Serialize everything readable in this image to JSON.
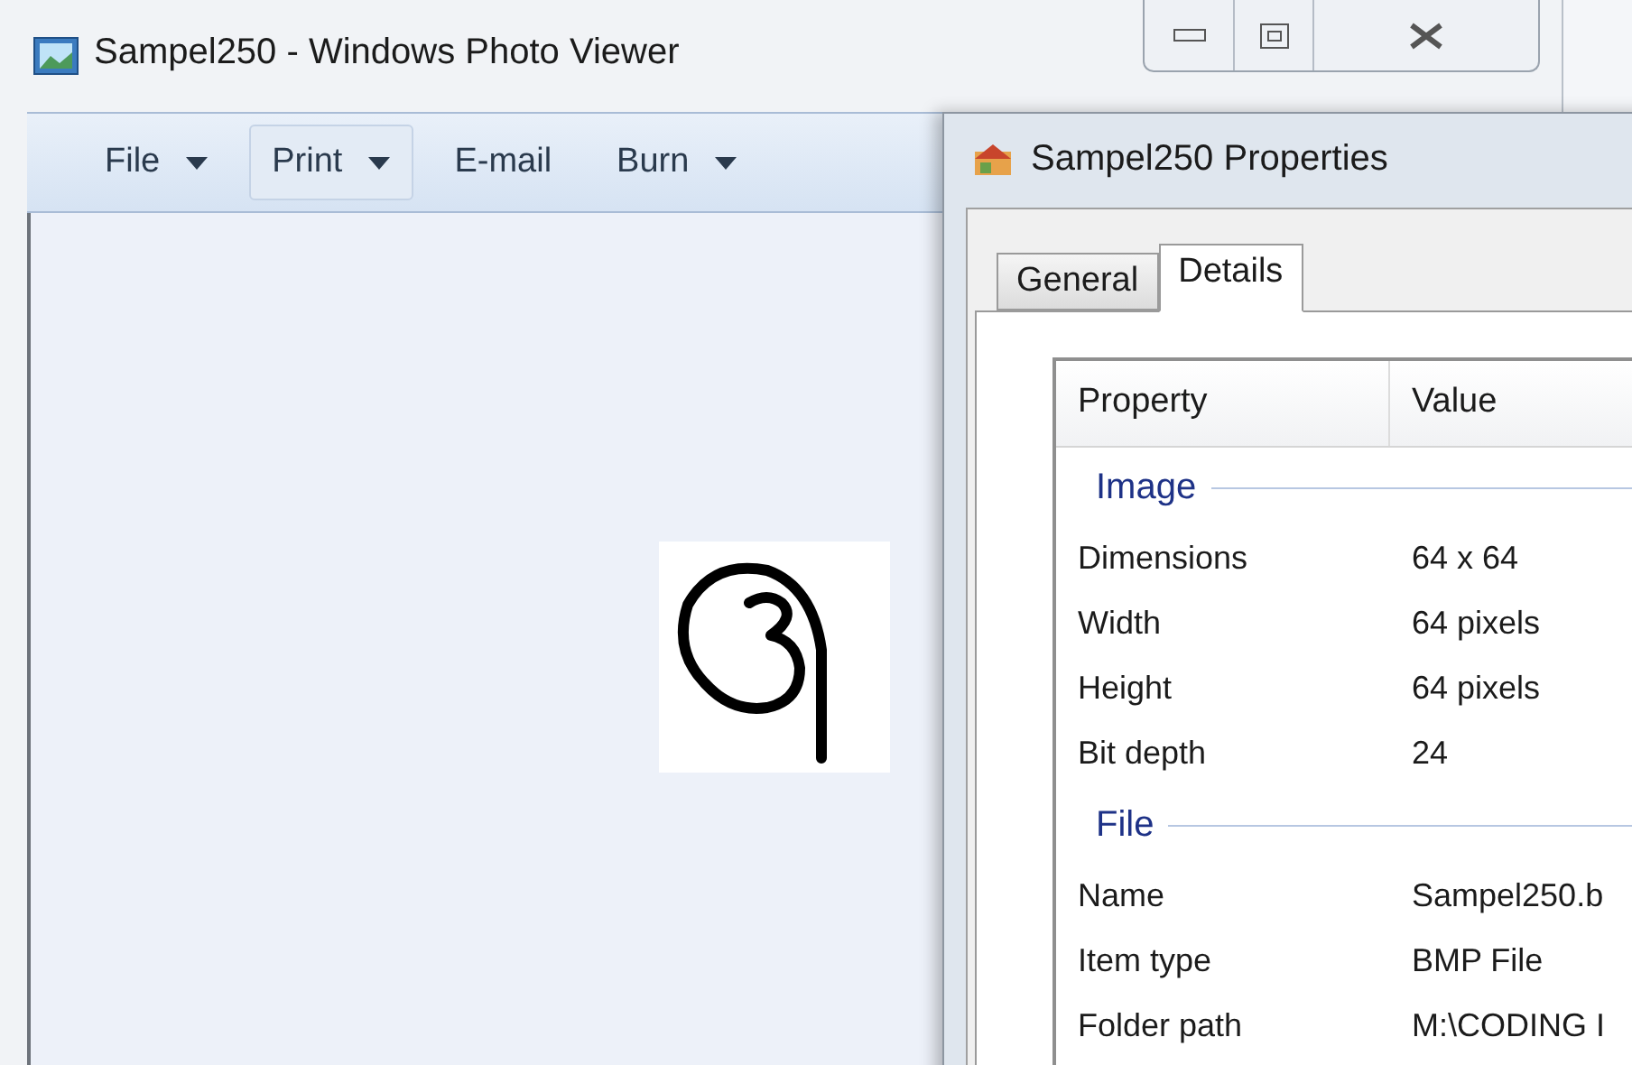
{
  "photo_viewer": {
    "title": "Sampel250 - Windows Photo Viewer",
    "toolbar": [
      {
        "label": "File",
        "dropdown": true,
        "hovered": false
      },
      {
        "label": "Print",
        "dropdown": true,
        "hovered": true
      },
      {
        "label": "E-mail",
        "dropdown": false,
        "hovered": false
      },
      {
        "label": "Burn",
        "dropdown": true,
        "hovered": false
      }
    ]
  },
  "properties": {
    "title": "Sampel250 Properties",
    "tabs": [
      {
        "label": "General",
        "selected": false
      },
      {
        "label": "Details",
        "selected": true
      }
    ],
    "columns": [
      "Property",
      "Value"
    ],
    "groups": [
      {
        "title": "Image",
        "rows": [
          {
            "property": "Dimensions",
            "value": "64 x 64"
          },
          {
            "property": "Width",
            "value": "64 pixels"
          },
          {
            "property": "Height",
            "value": "64 pixels"
          },
          {
            "property": "Bit depth",
            "value": "24"
          }
        ]
      },
      {
        "title": "File",
        "rows": [
          {
            "property": "Name",
            "value": "Sampel250.b"
          },
          {
            "property": "Item type",
            "value": "BMP File"
          },
          {
            "property": "Folder path",
            "value": "M:\\CODING I"
          }
        ]
      }
    ]
  }
}
